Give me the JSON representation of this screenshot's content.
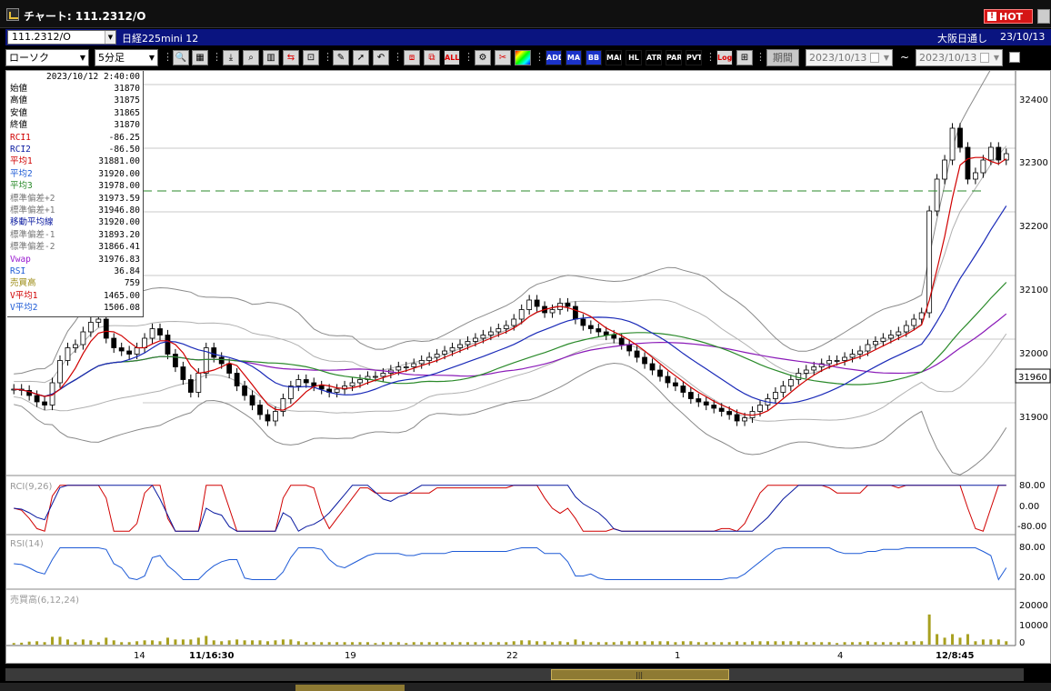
{
  "window": {
    "title": "チャート: 111.2312/O",
    "hot_label": "HOT",
    "hot_bang": "!"
  },
  "infobar": {
    "code": "111.2312/O",
    "name": "日経225mini 12",
    "market": "大阪日通し",
    "date": "23/10/13"
  },
  "toolbar": {
    "chart_type": "ローソク",
    "timeframe": "5分足",
    "period_label": "期間",
    "date_from": "2023/10/13",
    "date_to": "2023/10/13",
    "range_sep": "~",
    "text_buttons": [
      "ADD",
      "MA",
      "BB",
      "MAE",
      "HL",
      "ATR",
      "PAR",
      "PVT"
    ],
    "all_label": "ALL",
    "log_label": "Log"
  },
  "data_panel": {
    "timestamp": "2023/10/12 2:40:00",
    "rows": [
      {
        "label": "始値",
        "value": "31870",
        "color": "#000000"
      },
      {
        "label": "高値",
        "value": "31875",
        "color": "#000000"
      },
      {
        "label": "安値",
        "value": "31865",
        "color": "#000000"
      },
      {
        "label": "終値",
        "value": "31870",
        "color": "#000000"
      },
      {
        "label": "RCI1",
        "value": "-86.25",
        "color": "#d00000"
      },
      {
        "label": "RCI2",
        "value": "-86.50",
        "color": "#0a1aa0"
      },
      {
        "label": "平均1",
        "value": "31881.00",
        "color": "#d00000"
      },
      {
        "label": "平均2",
        "value": "31920.00",
        "color": "#1d5ad6"
      },
      {
        "label": "平均3",
        "value": "31978.00",
        "color": "#2a8a2a"
      },
      {
        "label": "標準偏差+2",
        "value": "31973.59",
        "color": "#777777"
      },
      {
        "label": "標準偏差+1",
        "value": "31946.80",
        "color": "#777777"
      },
      {
        "label": "移動平均線",
        "value": "31920.00",
        "color": "#0a1aa0"
      },
      {
        "label": "標準偏差-1",
        "value": "31893.20",
        "color": "#777777"
      },
      {
        "label": "標準偏差-2",
        "value": "31866.41",
        "color": "#777777"
      },
      {
        "label": "Vwap",
        "value": "31976.83",
        "color": "#9a1ad0"
      },
      {
        "label": "RSI",
        "value": "36.84",
        "color": "#1d5ad6"
      },
      {
        "label": "売買高",
        "value": "759",
        "color": "#9a8a10"
      },
      {
        "label": "V平均1",
        "value": "1465.00",
        "color": "#d00000"
      },
      {
        "label": "V平均2",
        "value": "1506.08",
        "color": "#1d5ad6"
      }
    ]
  },
  "price_axis": {
    "ticks": [
      "32400",
      "32300",
      "32200",
      "32100",
      "32000",
      "31900"
    ],
    "current_price": "31960"
  },
  "rci_pane": {
    "label": "RCI(9,26)",
    "ticks": [
      "80.00",
      "0.00",
      "-80.00"
    ]
  },
  "rsi_pane": {
    "label": "RSI(14)",
    "ticks": [
      "80.00",
      "20.00"
    ]
  },
  "volume_pane": {
    "label": "売買高(6,12,24)",
    "ticks": [
      "20000",
      "10000",
      "0"
    ]
  },
  "x_axis": {
    "labels": [
      "14",
      "11/16:30",
      "19",
      "22",
      "1",
      "4",
      "12/8:45"
    ]
  },
  "colors": {
    "candle_up": "#ffffff",
    "candle_down": "#000000",
    "ma1": "#d00000",
    "ma2": "#1a2ab8",
    "ma3": "#2a8a2a",
    "vwap": "#8a1ab8",
    "bands": "#8a8a8a",
    "rsi": "#1d5ad6",
    "volume": "#a8a020"
  },
  "chart_data": {
    "type": "candlestick",
    "y_axis": {
      "min": 31820,
      "max": 32420
    },
    "current_price": 31960,
    "close_series": [
      31920,
      31918,
      31910,
      31900,
      31895,
      31930,
      31965,
      31985,
      31990,
      32010,
      32025,
      32030,
      32000,
      31985,
      31980,
      31975,
      31985,
      32000,
      32015,
      32005,
      31975,
      31955,
      31935,
      31915,
      31945,
      31985,
      31970,
      31960,
      31945,
      31925,
      31910,
      31895,
      31880,
      31870,
      31885,
      31905,
      31925,
      31935,
      31930,
      31925,
      31920,
      31915,
      31920,
      31925,
      31930,
      31935,
      31940,
      31940,
      31945,
      31950,
      31955,
      31955,
      31960,
      31965,
      31970,
      31975,
      31980,
      31985,
      31990,
      31995,
      32000,
      32005,
      32010,
      32015,
      32020,
      32030,
      32045,
      32060,
      32050,
      32040,
      32045,
      32055,
      32050,
      32030,
      32020,
      32015,
      32010,
      32005,
      32000,
      31990,
      31980,
      31970,
      31960,
      31950,
      31940,
      31930,
      31925,
      31915,
      31905,
      31900,
      31895,
      31890,
      31885,
      31880,
      31870,
      31875,
      31885,
      31895,
      31905,
      31915,
      31925,
      31935,
      31945,
      31950,
      31955,
      31960,
      31965,
      31965,
      31970,
      31975,
      31980,
      31990,
      31995,
      32000,
      32005,
      32010,
      32020,
      32030,
      32040,
      32200,
      32250,
      32280,
      32330,
      32300,
      32250,
      32260,
      32280,
      32300,
      32280,
      32290
    ]
  }
}
